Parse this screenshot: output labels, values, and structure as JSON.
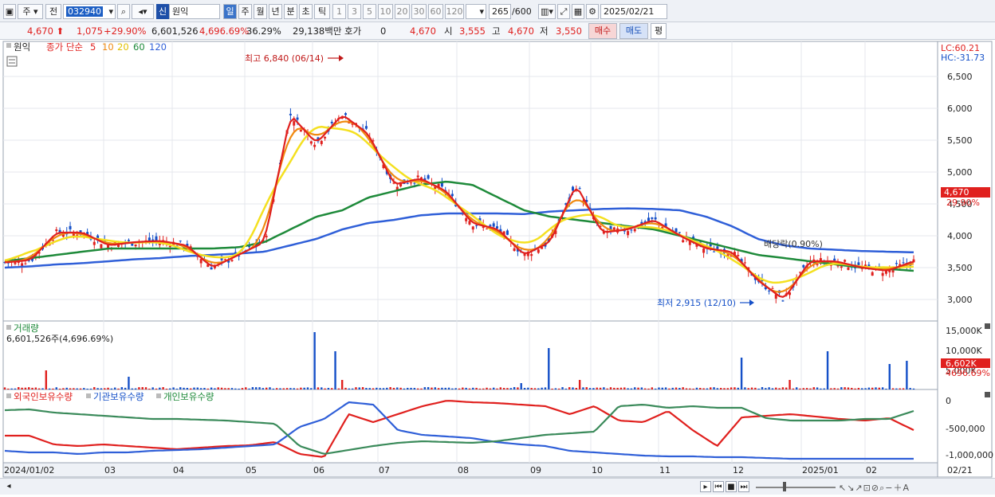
{
  "toolbar": {
    "market_label": "주",
    "prev_label": "전",
    "code": "032940",
    "badge": "신",
    "name": "원익",
    "periods": [
      "일",
      "주",
      "월",
      "년",
      "분",
      "초",
      "틱"
    ],
    "active_period": "일",
    "minutes": [
      "1",
      "3",
      "5",
      "10",
      "20",
      "30",
      "60",
      "120"
    ],
    "count": "265",
    "count_total": "/600",
    "date": "2025/02/21"
  },
  "quote": {
    "price": "4,670",
    "change": "1,075",
    "change_pct": "+29.90%",
    "volume": "6,601,526",
    "volume_pct": "4,696.69%",
    "turnover_pct": "36.29%",
    "amount": "29,138백만",
    "hoga_label": "호가",
    "hoga_value": "0",
    "hoga_price": "4,670",
    "open_label": "시",
    "open": "3,555",
    "high_label": "고",
    "high": "4,670",
    "low_label": "저",
    "low": "3,550",
    "buy_label": "매수",
    "sell_label": "매도",
    "avg_label": "평"
  },
  "price_panel": {
    "title": "원익",
    "ma_label": "종가 단순",
    "ma_periods": [
      "5",
      "10",
      "20",
      "60",
      "120"
    ],
    "lc": "LC:60.21",
    "hc": "HC:-31.73",
    "high_annot": "최고 6,840 (06/14)",
    "low_annot": "최저 2,915 (12/10)",
    "dividend_annot": "배당락(0.90%)",
    "last_price": "4,670",
    "last_pct": "29.90%",
    "y_ticks": [
      "6,500",
      "6,000",
      "5,500",
      "5,000",
      "4,500",
      "4,000",
      "3,500",
      "3,000"
    ]
  },
  "volume_panel": {
    "title": "거래량",
    "readout": "6,601,526주(4,696.69%)",
    "y_ticks": [
      "15,000K",
      "10,000K",
      "5,000K"
    ],
    "last": "6,602K",
    "last_pct": "4696.69%"
  },
  "holding_panel": {
    "series_labels": [
      "외국인보유수량",
      "기관보유수량",
      "개인보유수량"
    ],
    "y_ticks": [
      "0",
      "-500,000",
      "-1,000,000"
    ]
  },
  "x_axis": [
    "2024/01/02",
    "03",
    "04",
    "05",
    "06",
    "07",
    "08",
    "09",
    "10",
    "11",
    "12",
    "2025/01",
    "02"
  ],
  "x_axis_right": "02/21",
  "colors": {
    "up": "#e0201e",
    "down": "#1550c8",
    "ma5": "#e0201e",
    "ma10": "#f08a10",
    "ma20": "#f4e020",
    "ma60": "#1e8a3a",
    "ma120": "#2f5fd8"
  },
  "chart_data": {
    "type": "line",
    "title": "원익",
    "series": [
      {
        "name": "종가 단순 5",
        "values": [
          3580,
          3620,
          4050,
          4050,
          3850,
          3900,
          3920,
          3850,
          3500,
          3700,
          3900,
          5900,
          5450,
          5900,
          5600,
          4800,
          4900,
          4700,
          4200,
          4100,
          3700,
          3900,
          4800,
          4050,
          4100,
          4250,
          4000,
          3800,
          3750,
          3300,
          3000,
          3600,
          3600,
          3500,
          3450,
          3600
        ]
      },
      {
        "name": "60",
        "values": [
          3600,
          3650,
          3700,
          3750,
          3800,
          3800,
          3800,
          3800,
          3800,
          3820,
          3900,
          4100,
          4300,
          4400,
          4600,
          4700,
          4800,
          4850,
          4800,
          4600,
          4400,
          4300,
          4250,
          4200,
          4150,
          4100,
          4000,
          3900,
          3800,
          3700,
          3650,
          3600,
          3550,
          3500,
          3480,
          3450
        ]
      },
      {
        "name": "120",
        "values": [
          3500,
          3520,
          3550,
          3570,
          3600,
          3630,
          3650,
          3680,
          3700,
          3720,
          3750,
          3850,
          3950,
          4100,
          4200,
          4250,
          4320,
          4350,
          4350,
          4350,
          4340,
          4380,
          4400,
          4420,
          4430,
          4420,
          4400,
          4300,
          4150,
          3950,
          3850,
          3800,
          3780,
          3760,
          3750,
          3740
        ]
      }
    ]
  }
}
